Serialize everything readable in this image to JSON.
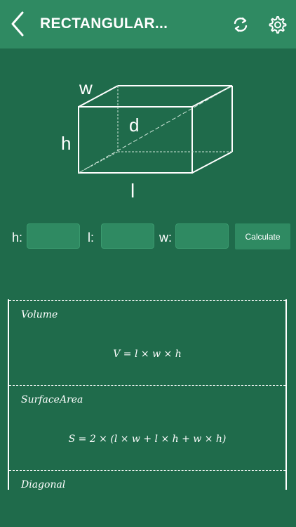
{
  "header": {
    "title": "RECTANGULAR...",
    "back_icon": "chevron-left-icon",
    "refresh_icon": "refresh-icon",
    "settings_icon": "gear-icon"
  },
  "diagram": {
    "label_w": "w",
    "label_h": "h",
    "label_d": "d",
    "label_l": "l"
  },
  "inputs": {
    "h_label": "h:",
    "l_label": "l:",
    "w_label": "w:",
    "h_value": "",
    "l_value": "",
    "w_value": "",
    "calculate_label": "Calculate"
  },
  "formulas": [
    {
      "name": "Volume",
      "expression": "V = l × w × h"
    },
    {
      "name": "SurfaceArea",
      "expression": "S = 2 × (l × w + l × h + w × h)"
    },
    {
      "name": "Diagonal",
      "expression": ""
    }
  ],
  "colors": {
    "background": "#1f6b4b",
    "header": "#2f8a62",
    "accent": "#2f8a62"
  }
}
